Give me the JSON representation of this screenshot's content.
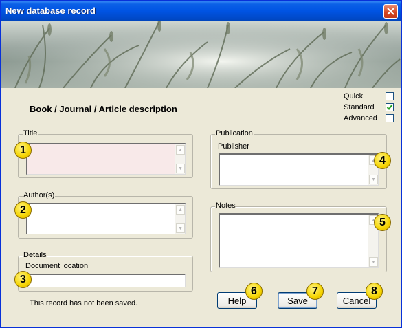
{
  "window": {
    "title": "New database record"
  },
  "header": {
    "description": "Book / Journal / Article description"
  },
  "mode": {
    "quick_label": "Quick",
    "standard_label": "Standard",
    "advanced_label": "Advanced",
    "selected": "Standard"
  },
  "title_group": {
    "legend": "Title",
    "value": ""
  },
  "authors_group": {
    "legend": "Author(s)",
    "value": ""
  },
  "details_group": {
    "legend": "Details",
    "document_location_label": "Document location",
    "document_location_value": ""
  },
  "publication_group": {
    "legend": "Publication",
    "publisher_label": "Publisher",
    "publisher_value": ""
  },
  "notes_group": {
    "legend": "Notes",
    "value": ""
  },
  "status": "This record has not been saved.",
  "buttons": {
    "help": "Help",
    "save": "Save",
    "cancel": "Cancel"
  },
  "badges": [
    "1",
    "2",
    "3",
    "4",
    "5",
    "6",
    "7",
    "8"
  ],
  "icons": {
    "close": "close-icon",
    "checkmark": "checkmark-icon",
    "scroll_up": "scroll-up-arrow-icon",
    "scroll_down": "scroll-down-arrow-icon"
  },
  "colors": {
    "titlebar": "#0054e3",
    "title_field": "#f8e9e9",
    "badge": "#f5d400"
  }
}
